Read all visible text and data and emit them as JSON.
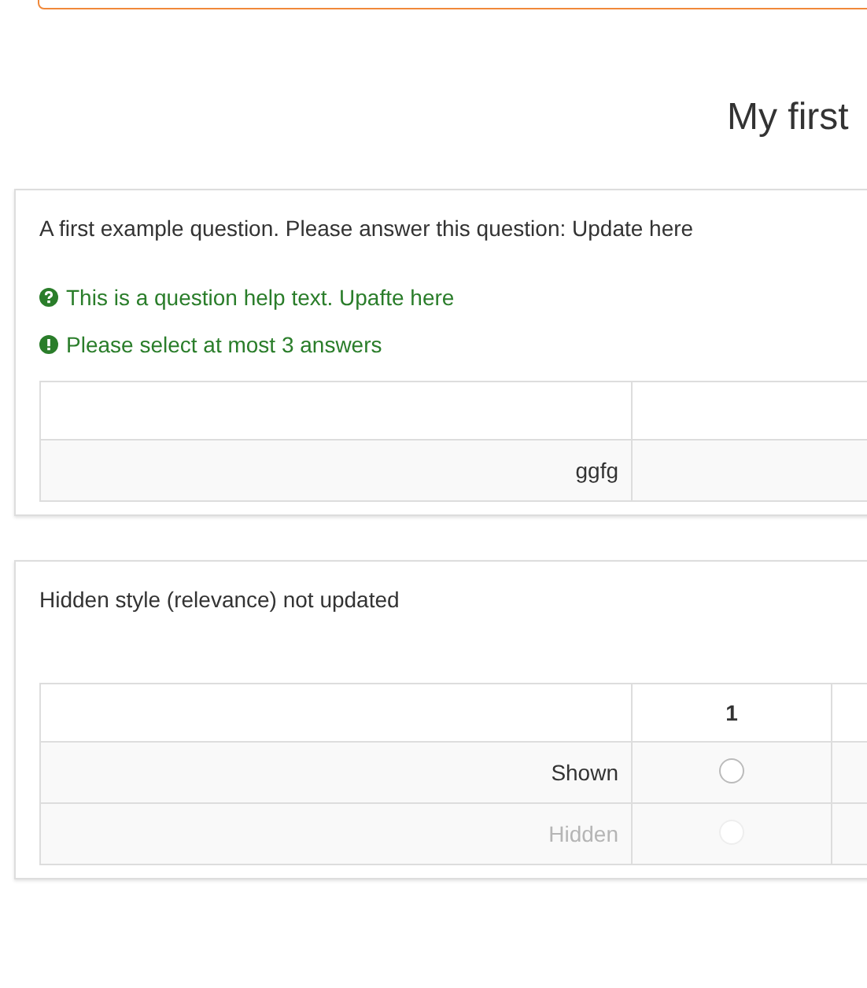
{
  "survey_title": "My first",
  "questions": [
    {
      "text": "A first example question. Please answer this question: Update here",
      "help": "This is a question help text. Upafte here",
      "tip": "Please select at most 3 answers",
      "rows": [
        {
          "label": "ggfg",
          "hidden": false
        }
      ]
    },
    {
      "text": "Hidden style (relevance) not updated",
      "columns": [
        "1"
      ],
      "rows": [
        {
          "label": "Shown",
          "hidden": false,
          "options": [
            {
              "selected": false
            }
          ]
        },
        {
          "label": "Hidden",
          "hidden": true,
          "options": [
            {
              "selected": false
            }
          ]
        }
      ]
    }
  ]
}
